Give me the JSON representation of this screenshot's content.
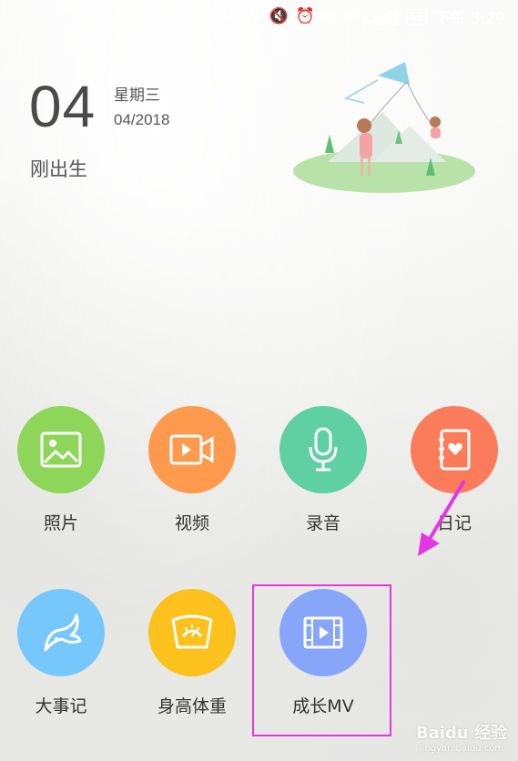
{
  "status_bar": {
    "speed": "58B/s",
    "battery": "69",
    "time": "下午 3:29"
  },
  "header": {
    "day": "04",
    "weekday": "星期三",
    "month_year": "04/2018",
    "age_label": "刚出生"
  },
  "grid": {
    "items": [
      {
        "label": "照片",
        "icon": "image-icon",
        "color": "#8dd65a"
      },
      {
        "label": "视频",
        "icon": "video-camera-icon",
        "color": "#fd9a4d"
      },
      {
        "label": "录音",
        "icon": "microphone-icon",
        "color": "#5ed0a3"
      },
      {
        "label": "日记",
        "icon": "diary-heart-icon",
        "color": "#fb7c5b"
      },
      {
        "label": "大事记",
        "icon": "fish-tail-icon",
        "color": "#76c7fb"
      },
      {
        "label": "身高体重",
        "icon": "scale-icon",
        "color": "#fcc11c"
      },
      {
        "label": "成长MV",
        "icon": "film-play-icon",
        "color": "#87a6fa"
      }
    ]
  },
  "annotation": {
    "color": "#e437e3"
  },
  "watermark": {
    "brand": "Baidu 经验",
    "url": "jingyan.baidu.com"
  }
}
